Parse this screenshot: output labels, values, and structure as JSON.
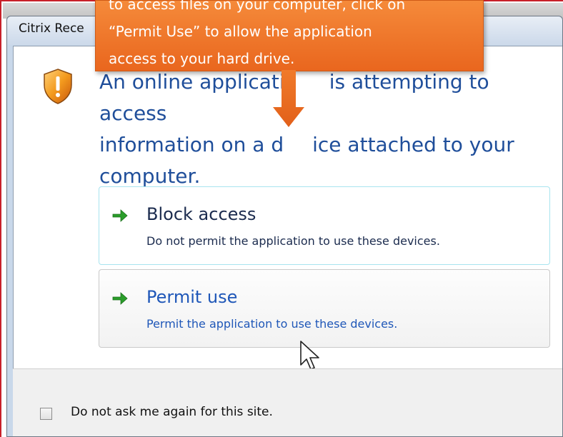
{
  "background": {
    "strip_text": "",
    "frame_color": "#c8202a"
  },
  "dialog": {
    "title": "Citrix Rece",
    "heading_lines": [
      "An online applicati",
      "information on a d",
      "computer."
    ],
    "heading_lines_right": [
      "is attempting to access",
      "ice attached to your"
    ],
    "shield_icon": "warning-shield-icon",
    "options": [
      {
        "id": "block",
        "title": "Block access",
        "description": "Do not permit the application to use these devices.",
        "icon": "green-arrow-icon"
      },
      {
        "id": "permit",
        "title": "Permit use",
        "description": "Permit the application to use these devices.",
        "icon": "green-arrow-icon"
      }
    ],
    "footer": {
      "checkbox_label": "Do not ask me again for this site.",
      "checked": false
    }
  },
  "callout": {
    "text_lines": [
      "to access files on your computer, click on",
      "“Permit Use” to allow the application",
      "access to your hard drive."
    ],
    "color": "#ef7a2c"
  },
  "colors": {
    "heading": "#1f4e9a",
    "permit_text": "#1f57b8",
    "arrow_green": "#2a9d2a"
  }
}
